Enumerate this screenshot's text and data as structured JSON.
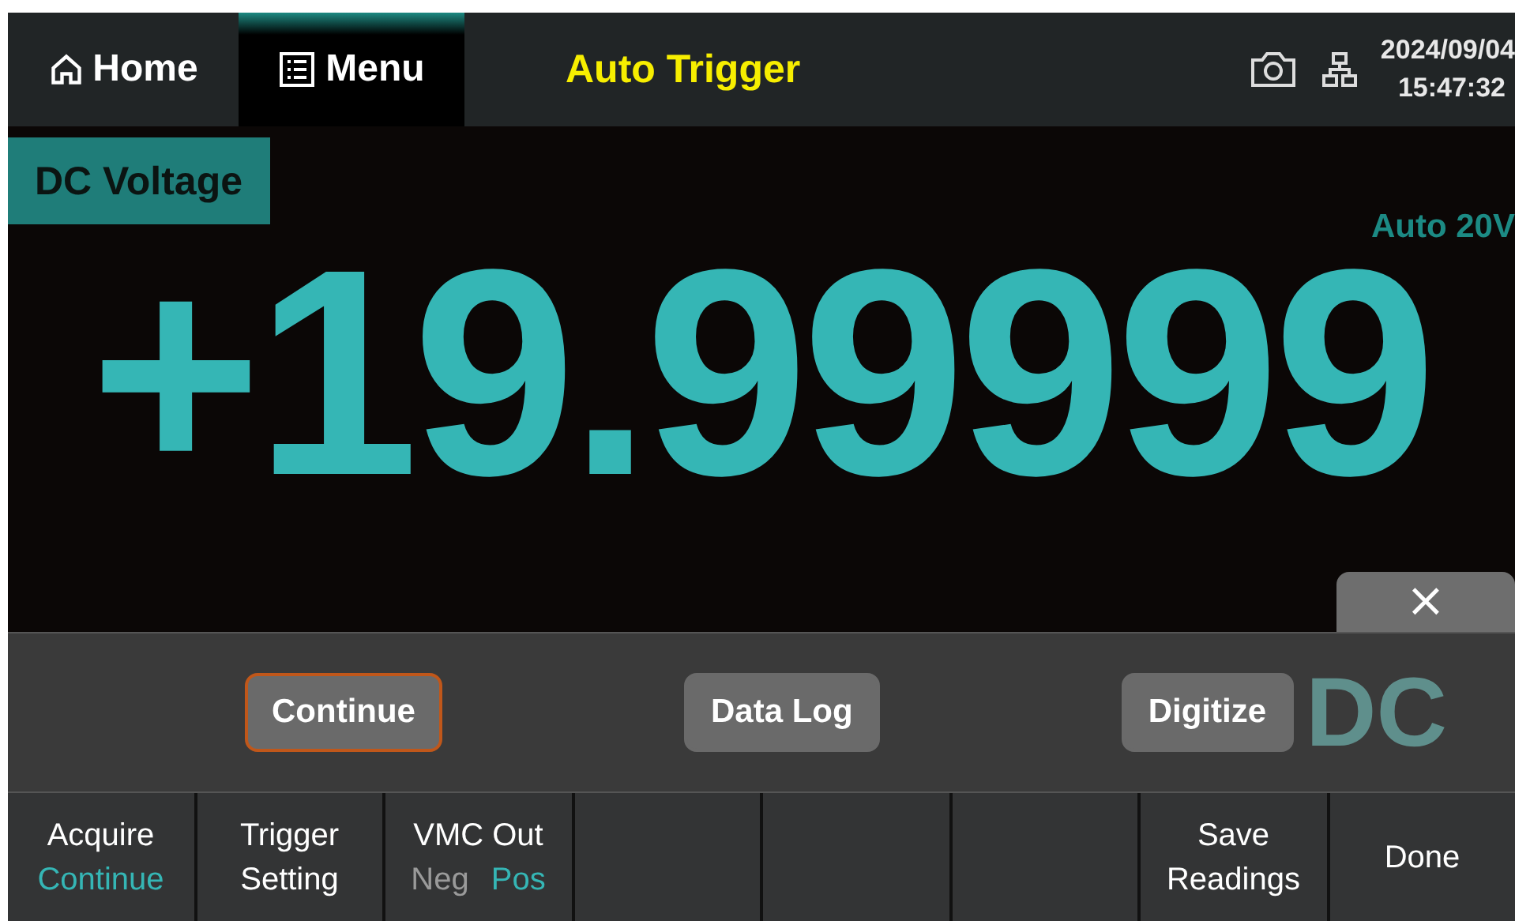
{
  "top_bar": {
    "tabs": [
      {
        "label": "Home",
        "selected": false
      },
      {
        "label": "Menu",
        "selected": true
      }
    ],
    "title": "Auto Trigger",
    "date": "2024/09/04",
    "time": "15:47:32"
  },
  "measurement": {
    "function": "DC Voltage",
    "range": "Auto 20V",
    "reading": "+19.99999",
    "unit": "DC"
  },
  "popup": {
    "buttons": [
      {
        "label": "Continue",
        "selected": true
      },
      {
        "label": "Data Log",
        "selected": false
      },
      {
        "label": "Digitize",
        "selected": false
      }
    ],
    "close": "×"
  },
  "softkeys": [
    {
      "kind": "value",
      "label": "Acquire",
      "value": "Continue"
    },
    {
      "kind": "plain",
      "label": "Trigger Setting"
    },
    {
      "kind": "toggle",
      "label": "VMC Out",
      "options": [
        {
          "label": "Neg",
          "selected": false
        },
        {
          "label": "Pos",
          "selected": true
        }
      ]
    },
    {
      "kind": "empty"
    },
    {
      "kind": "empty"
    },
    {
      "kind": "empty"
    },
    {
      "kind": "plain",
      "label": "Save Readings"
    },
    {
      "kind": "plain",
      "label": "Done"
    }
  ]
}
